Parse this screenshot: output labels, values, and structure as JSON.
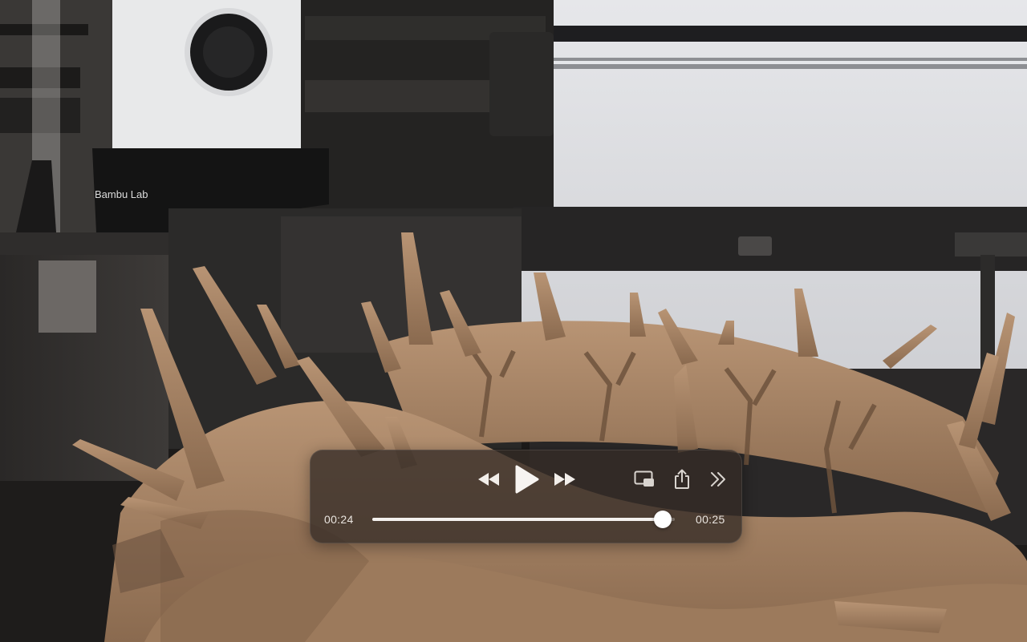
{
  "player": {
    "elapsed": "00:24",
    "total": "00:25",
    "progress_fraction": 0.96
  },
  "video": {
    "printer_brand": "Bambu Lab"
  },
  "controls": {
    "icons": [
      "rewind-icon",
      "play-icon",
      "fast-forward-icon",
      "picture-in-picture-icon",
      "share-icon",
      "chevron-double-right-icon"
    ]
  },
  "colors": {
    "panel": "#342c26",
    "text": "#e9e4df",
    "print_material": "#a88464"
  }
}
